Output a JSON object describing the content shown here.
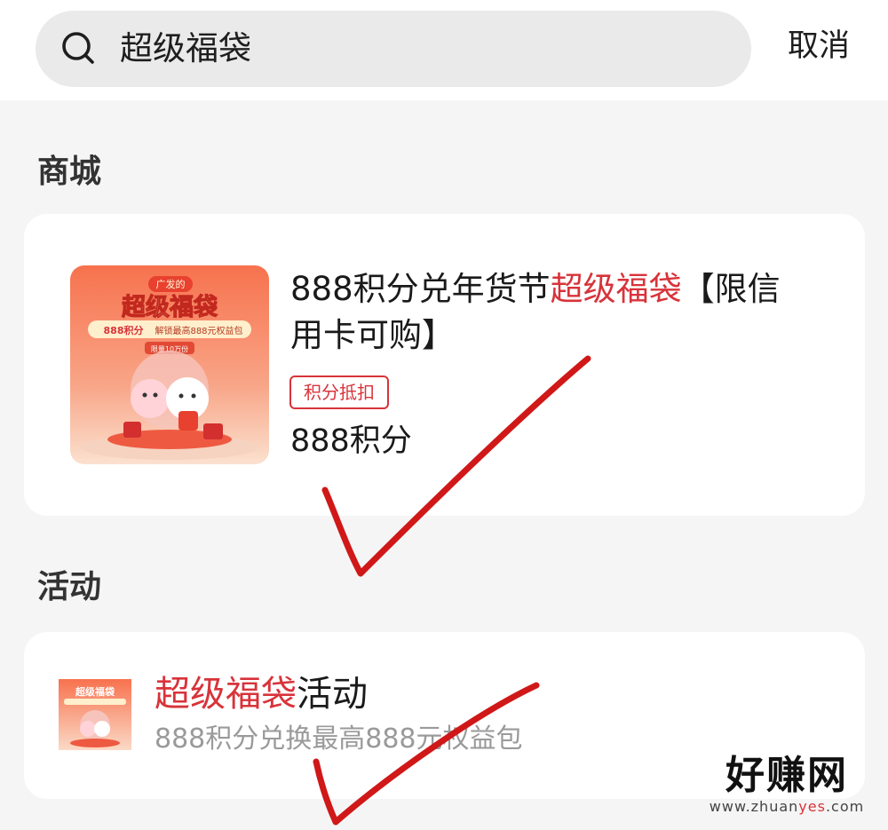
{
  "search": {
    "query": "超级福袋",
    "icon": "search-icon",
    "cancel_label": "取消"
  },
  "mall": {
    "section_title": "商城",
    "product": {
      "title_pre": "888积分兑年货节",
      "title_highlight": "超级福袋",
      "title_post": "【限信用卡可购】",
      "tag": "积分抵扣",
      "price": "888积分",
      "thumb": {
        "badge": "广发的",
        "headline": "超级福袋",
        "sub_highlight": "888积分",
        "sub_text": "解锁最高888元权益包",
        "limit": "限量10万份"
      }
    }
  },
  "activity": {
    "section_title": "活动",
    "item": {
      "title_highlight": "超级福袋",
      "title_post": "活动",
      "subtitle": "888积分兑换最高888元权益包",
      "thumb": {
        "headline": "超级福袋"
      }
    }
  },
  "watermark": {
    "main": "好赚网",
    "sub_pre": "www.zhuan",
    "sub_highlight": "yes",
    "sub_post": ".com"
  },
  "colors": {
    "accent": "#d8333a",
    "page_bg": "#f5f5f5",
    "card_bg": "#ffffff",
    "search_bg": "#eaeaea",
    "check_mark": "#d01818"
  }
}
